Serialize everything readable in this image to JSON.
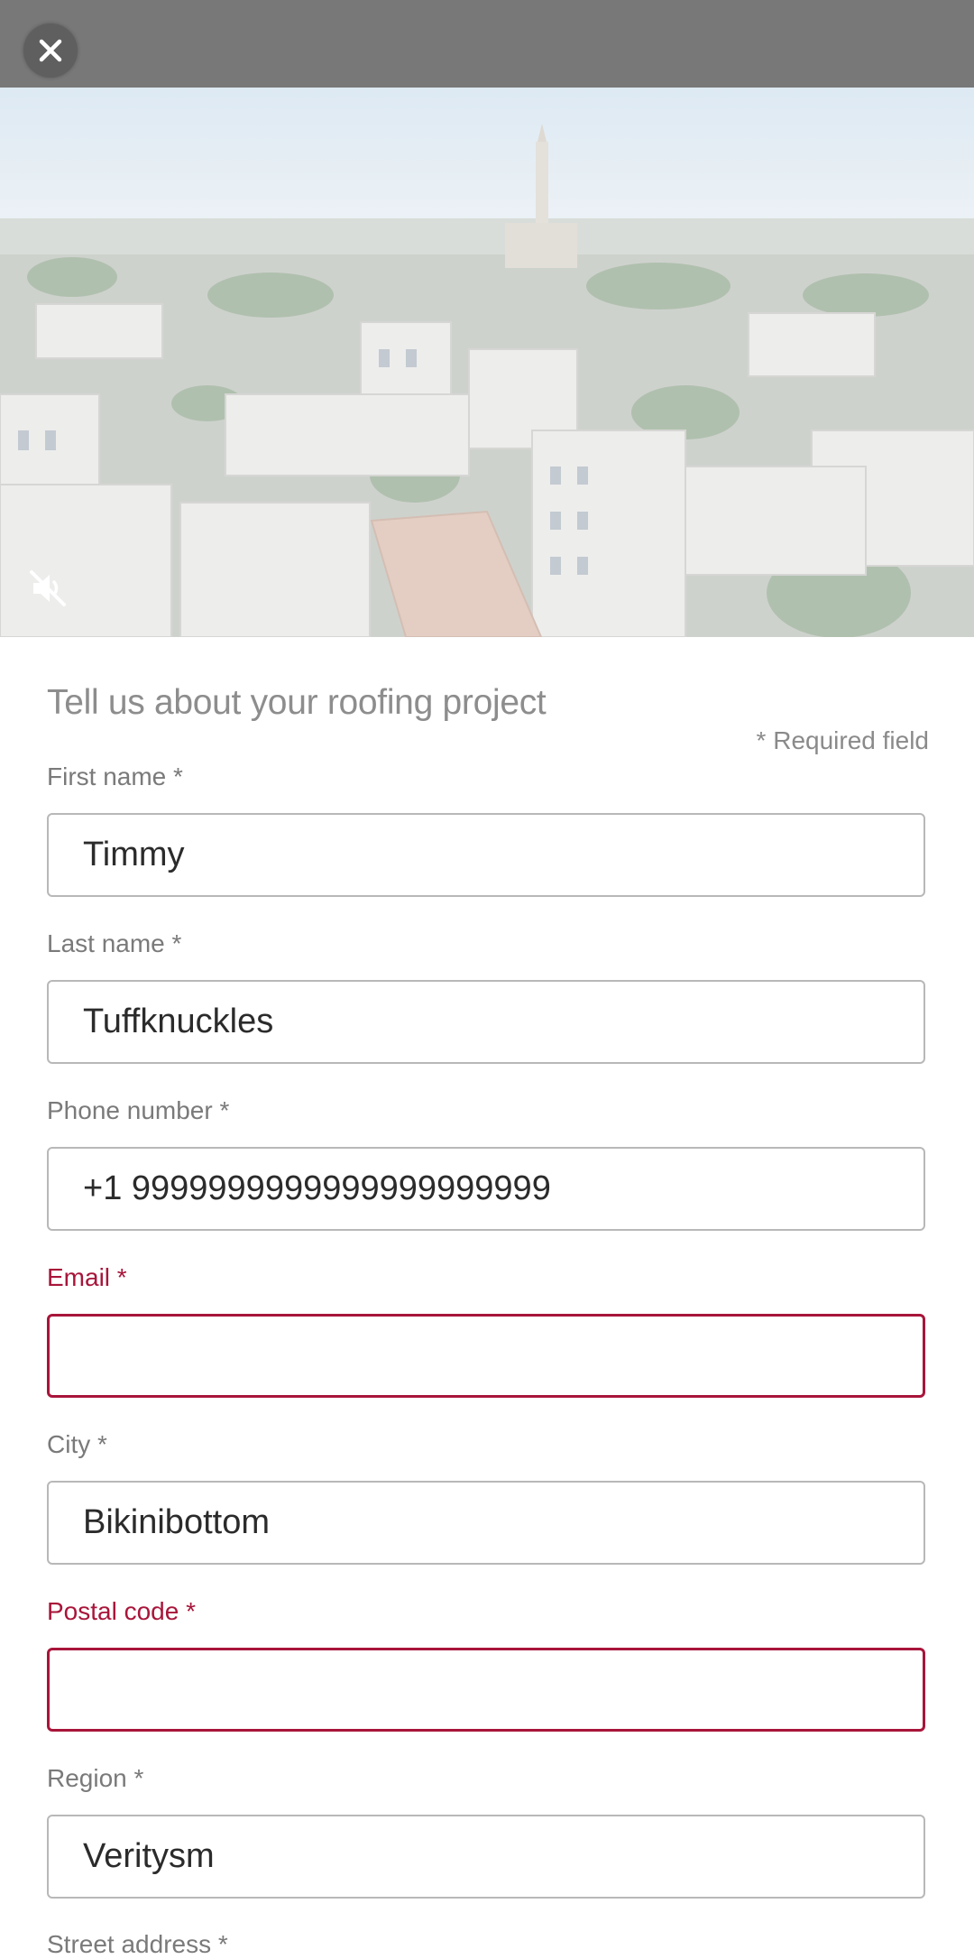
{
  "icons": {
    "close": "close-icon",
    "mute": "volume-muted-icon"
  },
  "colors": {
    "top_bar": "#787878",
    "error": "#a8153a",
    "label": "#7a7a7a",
    "input_border": "#b8b8b8"
  },
  "form": {
    "title": "Tell us about your roofing project",
    "required_note": "* Required field",
    "fields": [
      {
        "label": "First name *",
        "value": "Timmy",
        "error": false
      },
      {
        "label": "Last name *",
        "value": "Tuffknuckles",
        "error": false
      },
      {
        "label": "Phone number *",
        "value": "+1 9999999999999999999999",
        "error": false
      },
      {
        "label": "Email *",
        "value": "",
        "error": true
      },
      {
        "label": "City *",
        "value": "Bikinibottom",
        "error": false
      },
      {
        "label": "Postal code *",
        "value": "",
        "error": true
      },
      {
        "label": "Region *",
        "value": "Veritysm",
        "error": false
      },
      {
        "label": "Street address *",
        "value": "",
        "error": false
      }
    ]
  }
}
